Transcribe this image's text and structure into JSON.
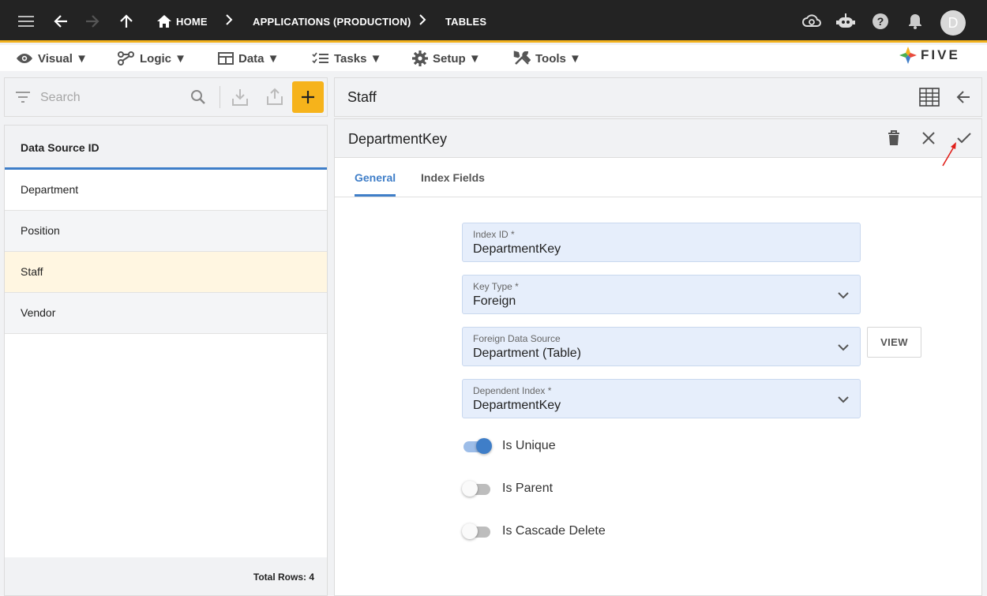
{
  "topbar": {
    "breadcrumbs": [
      "HOME",
      "APPLICATIONS (PRODUCTION)",
      "TABLES"
    ],
    "avatar_initial": "D"
  },
  "menubar": {
    "items": [
      {
        "label": "Visual ▼",
        "icon": "eye-icon"
      },
      {
        "label": "Logic ▼",
        "icon": "logic-icon"
      },
      {
        "label": "Data ▼",
        "icon": "table-icon"
      },
      {
        "label": "Tasks ▼",
        "icon": "tasks-icon"
      },
      {
        "label": "Setup ▼",
        "icon": "gear-icon"
      },
      {
        "label": "Tools ▼",
        "icon": "tools-icon"
      }
    ],
    "logo_text": "FIVE"
  },
  "left_panel": {
    "search_placeholder": "Search",
    "column_header": "Data Source ID",
    "rows": [
      "Department",
      "Position",
      "Staff",
      "Vendor"
    ],
    "selected_row": "Staff",
    "footer": "Total Rows: 4"
  },
  "right_panel": {
    "title": "Staff",
    "form_title": "DepartmentKey",
    "tabs": [
      "General",
      "Index Fields"
    ],
    "active_tab": "General",
    "fields": {
      "index_id": {
        "label": "Index ID *",
        "value": "DepartmentKey"
      },
      "key_type": {
        "label": "Key Type *",
        "value": "Foreign"
      },
      "foreign_data_source": {
        "label": "Foreign Data Source",
        "value": "Department (Table)"
      },
      "dependent_index": {
        "label": "Dependent Index *",
        "value": "DepartmentKey"
      }
    },
    "view_button": "VIEW",
    "toggles": [
      {
        "label": "Is Unique",
        "on": true
      },
      {
        "label": "Is Parent",
        "on": false
      },
      {
        "label": "Is Cascade Delete",
        "on": false
      }
    ]
  },
  "colors": {
    "accent": "#f6b31b",
    "primary": "#3f7ec8",
    "topbar": "#232323",
    "selected_row": "#fff6e1",
    "field_bg": "#e6eefb"
  }
}
